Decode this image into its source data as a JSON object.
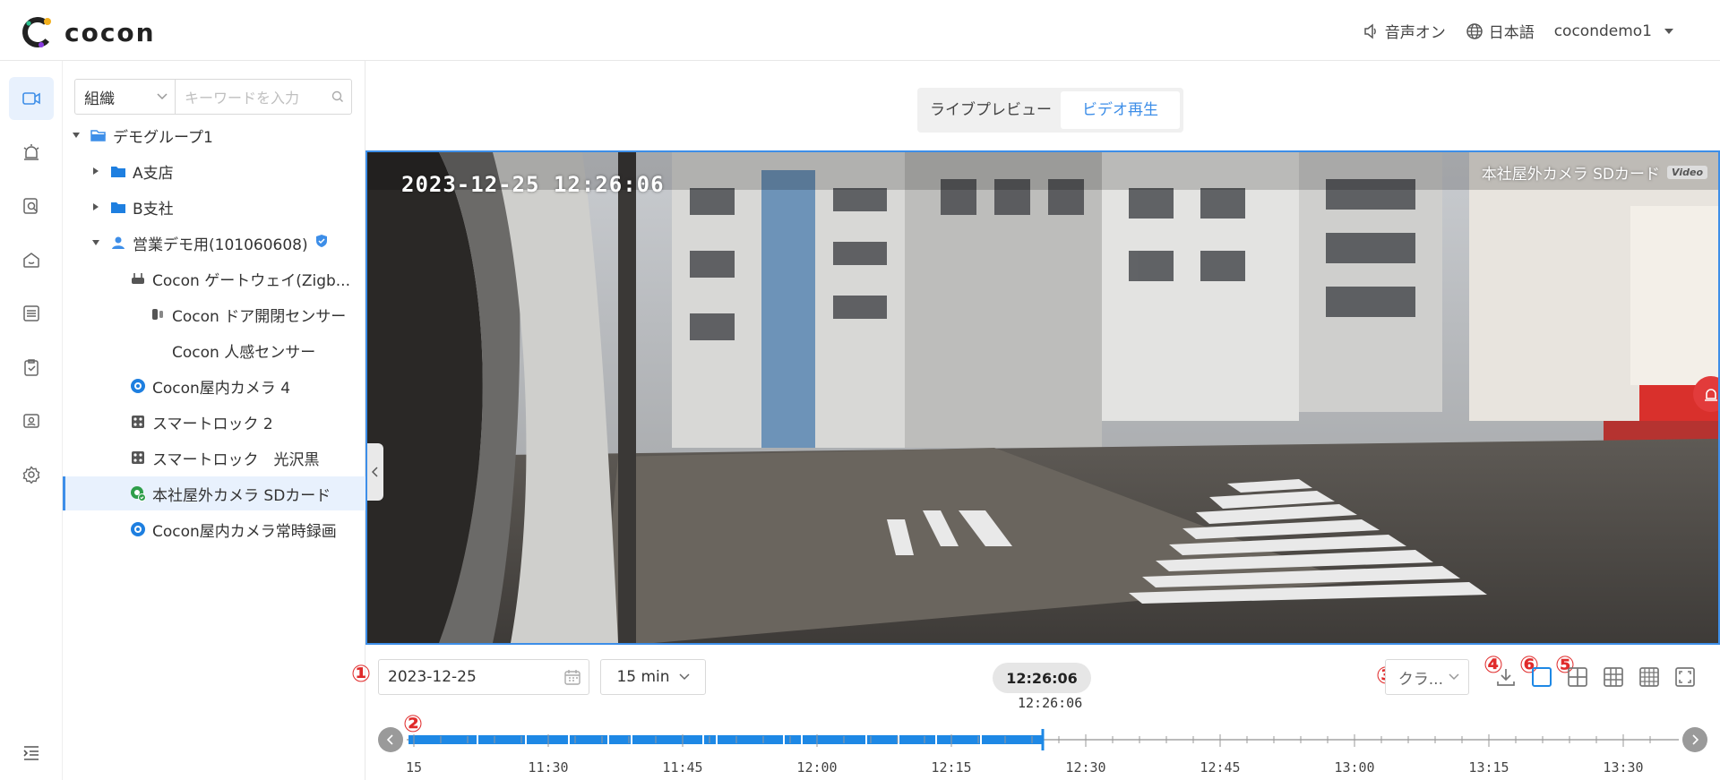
{
  "header": {
    "logo_text": "cocon",
    "sound_label": "音声オン",
    "language_label": "日本語",
    "user_label": "cocondemo1"
  },
  "icon_rail": [
    "video-camera-icon",
    "alarm-icon",
    "search-doc-icon",
    "home-icon",
    "list-icon",
    "clipboard-check-icon",
    "user-card-icon",
    "settings-icon"
  ],
  "sidebar": {
    "org_select": "組織",
    "search_placeholder": "キーワードを入力",
    "tree": [
      {
        "label": "デモグループ1",
        "icon": "folder-open-icon"
      },
      {
        "label": "A支店",
        "icon": "folder-icon"
      },
      {
        "label": "B支社",
        "icon": "folder-icon"
      },
      {
        "label": "営業デモ用(101060608)",
        "icon": "user-icon"
      },
      {
        "label": "Cocon ゲートウェイ(Zigb...",
        "icon": "gateway-icon"
      },
      {
        "label": "Cocon ドア開閉センサー",
        "icon": "door-sensor-icon"
      },
      {
        "label": "Cocon 人感センサー",
        "icon": ""
      },
      {
        "label": "Cocon屋内カメラ 4",
        "icon": "camera-icon"
      },
      {
        "label": "スマートロック 2",
        "icon": "lock-icon"
      },
      {
        "label": "スマートロック　光沢黒",
        "icon": "lock-icon"
      },
      {
        "label": "本社屋外カメラ SDカード",
        "icon": "outdoor-camera-icon"
      },
      {
        "label": "Cocon屋内カメラ常時録画",
        "icon": "camera-icon"
      }
    ]
  },
  "tabs": {
    "live": "ライブプレビュー",
    "playback": "ビデオ再生"
  },
  "video": {
    "timestamp": "2023-12-25  12:26:06",
    "camera_label": "本社屋外カメラ SDカード",
    "badge": "Video"
  },
  "controls": {
    "date": "2023-12-25",
    "range": "15 min",
    "current_time": "12:26:06",
    "cursor_time": "12:26:06",
    "quality": "クラ...",
    "annotations": [
      "①",
      "②",
      "③",
      "④",
      "⑥",
      "⑤"
    ]
  },
  "timeline": {
    "ticks": [
      "15",
      "11:30",
      "11:45",
      "12:00",
      "12:15",
      "12:30",
      "12:45",
      "13:00",
      "13:15",
      "13:30"
    ],
    "recorded_until_fraction": 0.5,
    "accent": "#1e88e5"
  },
  "colors": {
    "accent": "#3d8ee8",
    "annotation": "#e02b2b"
  }
}
